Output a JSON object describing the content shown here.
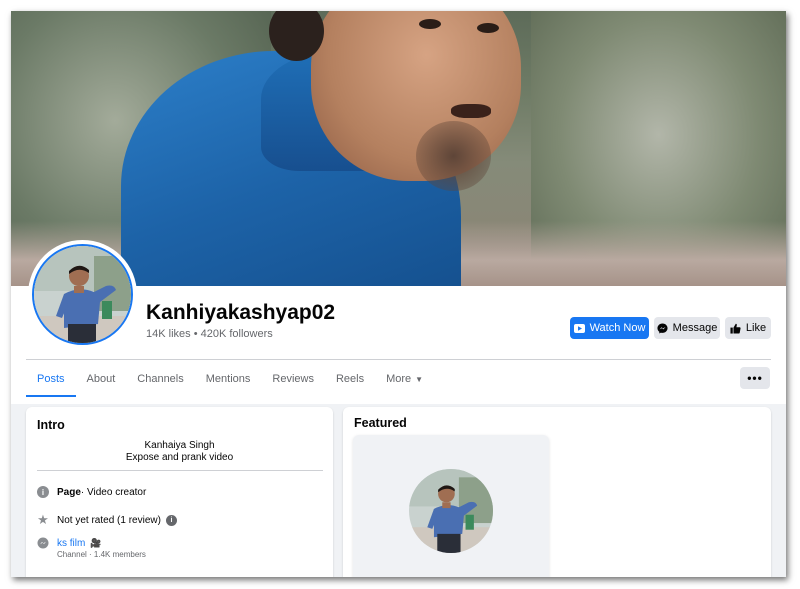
{
  "page": {
    "name": "Kanhiyakashyap02",
    "stats": "14K likes • 420K followers"
  },
  "actions": {
    "watch_now": "Watch Now",
    "message": "Message",
    "like": "Like",
    "more_options": "•••"
  },
  "tabs": [
    {
      "label": "Posts",
      "active": true
    },
    {
      "label": "About"
    },
    {
      "label": "Channels"
    },
    {
      "label": "Mentions"
    },
    {
      "label": "Reviews"
    },
    {
      "label": "Reels"
    },
    {
      "label": "More"
    }
  ],
  "intro": {
    "title": "Intro",
    "bio_name": "Kanhaiya Singh",
    "bio_text": "Expose and prank video",
    "page_label": "Page",
    "page_category": " · Video creator",
    "rating": "Not yet rated (1 review)",
    "channel_name": "ks film",
    "channel_emoji": "🎥",
    "channel_sub": "Channel · 1.4K members"
  },
  "featured": {
    "title": "Featured"
  },
  "colors": {
    "accent": "#1877f2",
    "secondary_button": "#e4e6eb",
    "page_background": "#f0f2f5",
    "muted_text": "#65676b"
  },
  "icons": {
    "info": "info-circle-icon",
    "star": "star-icon",
    "channel": "messenger-channel-icon",
    "watch": "video-play-icon",
    "message": "messenger-icon",
    "like": "thumbs-up-icon"
  }
}
